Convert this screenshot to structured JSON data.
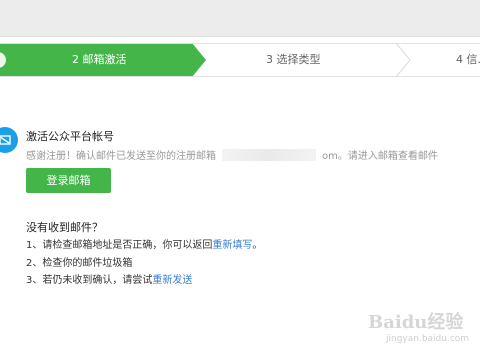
{
  "steps": {
    "active_label": "2 邮箱激活",
    "step3_label": "3 选择类型",
    "step4_label": "4 信..."
  },
  "activation": {
    "title": "激活公众平台帐号",
    "notice_before": "感谢注册！确认邮件已发送至你的注册邮箱",
    "notice_after": "om。请进入邮箱查看邮件",
    "login_button": "登录邮箱"
  },
  "help": {
    "title": "没有收到邮件？",
    "line1_text": "1、请检查邮箱地址是否正确，你可以返回",
    "line1_link": "重新填写",
    "line1_end": "。",
    "line2_text": "2、检查你的邮件垃圾箱",
    "line3_text": "3、若仍未收到确认，请尝试",
    "line3_link": "重新发送"
  },
  "watermark": {
    "text": "Baidu经验",
    "sub": "jingyan.baidu.com"
  },
  "colors": {
    "accent_green": "#44b549",
    "link_blue": "#3a7fd5",
    "icon_blue": "#1aa0e8"
  },
  "icons": [
    "mail-icon"
  ]
}
